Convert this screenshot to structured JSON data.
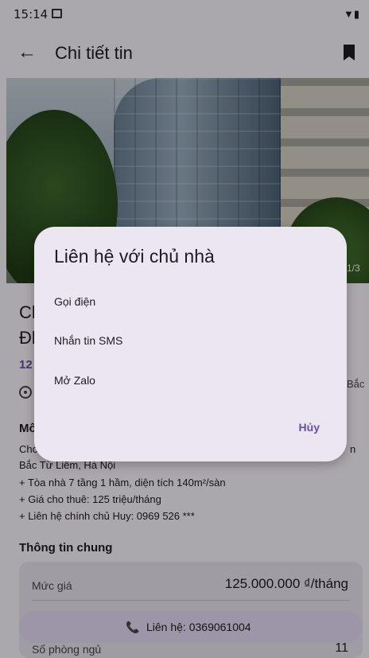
{
  "status_bar": {
    "time": "15:14"
  },
  "app_bar": {
    "title": "Chi tiết tin"
  },
  "hero": {
    "counter": "1/3"
  },
  "listing": {
    "title_fragment_line1": "Cl",
    "title_fragment_line2": "Đl",
    "price_fragment": "12",
    "address_tail": "Bắc"
  },
  "description": {
    "heading_fragment": "Mô",
    "line0_fragment": "Cho",
    "line0_tail": "n",
    "lines": [
      "Bắc Từ Liêm, Hà Nội",
      "+ Tòa nhà 7 tầng 1 hầm, diện tích 140m²/sàn",
      "+ Giá cho thuê: 125 triệu/tháng",
      "+ Liên hệ chính chủ Huy: 0969 526 ***"
    ]
  },
  "general_info": {
    "title": "Thông tin chung",
    "price_label": "Mức giá",
    "price_value": "125.000.000 ₫/tháng",
    "bedrooms_label": "Số phòng ngủ",
    "bedrooms_value": "11"
  },
  "contact_button": {
    "label": "Liên hệ: 0369061004"
  },
  "dialog": {
    "title": "Liên hệ với chủ nhà",
    "options": [
      "Gọi điện",
      "Nhắn tin SMS",
      "Mở Zalo"
    ],
    "cancel_label": "Hủy"
  },
  "colors": {
    "accent": "#6750a4",
    "dialog_bg": "#ece6f0",
    "scrim": "rgba(0,0,0,0.32)"
  }
}
